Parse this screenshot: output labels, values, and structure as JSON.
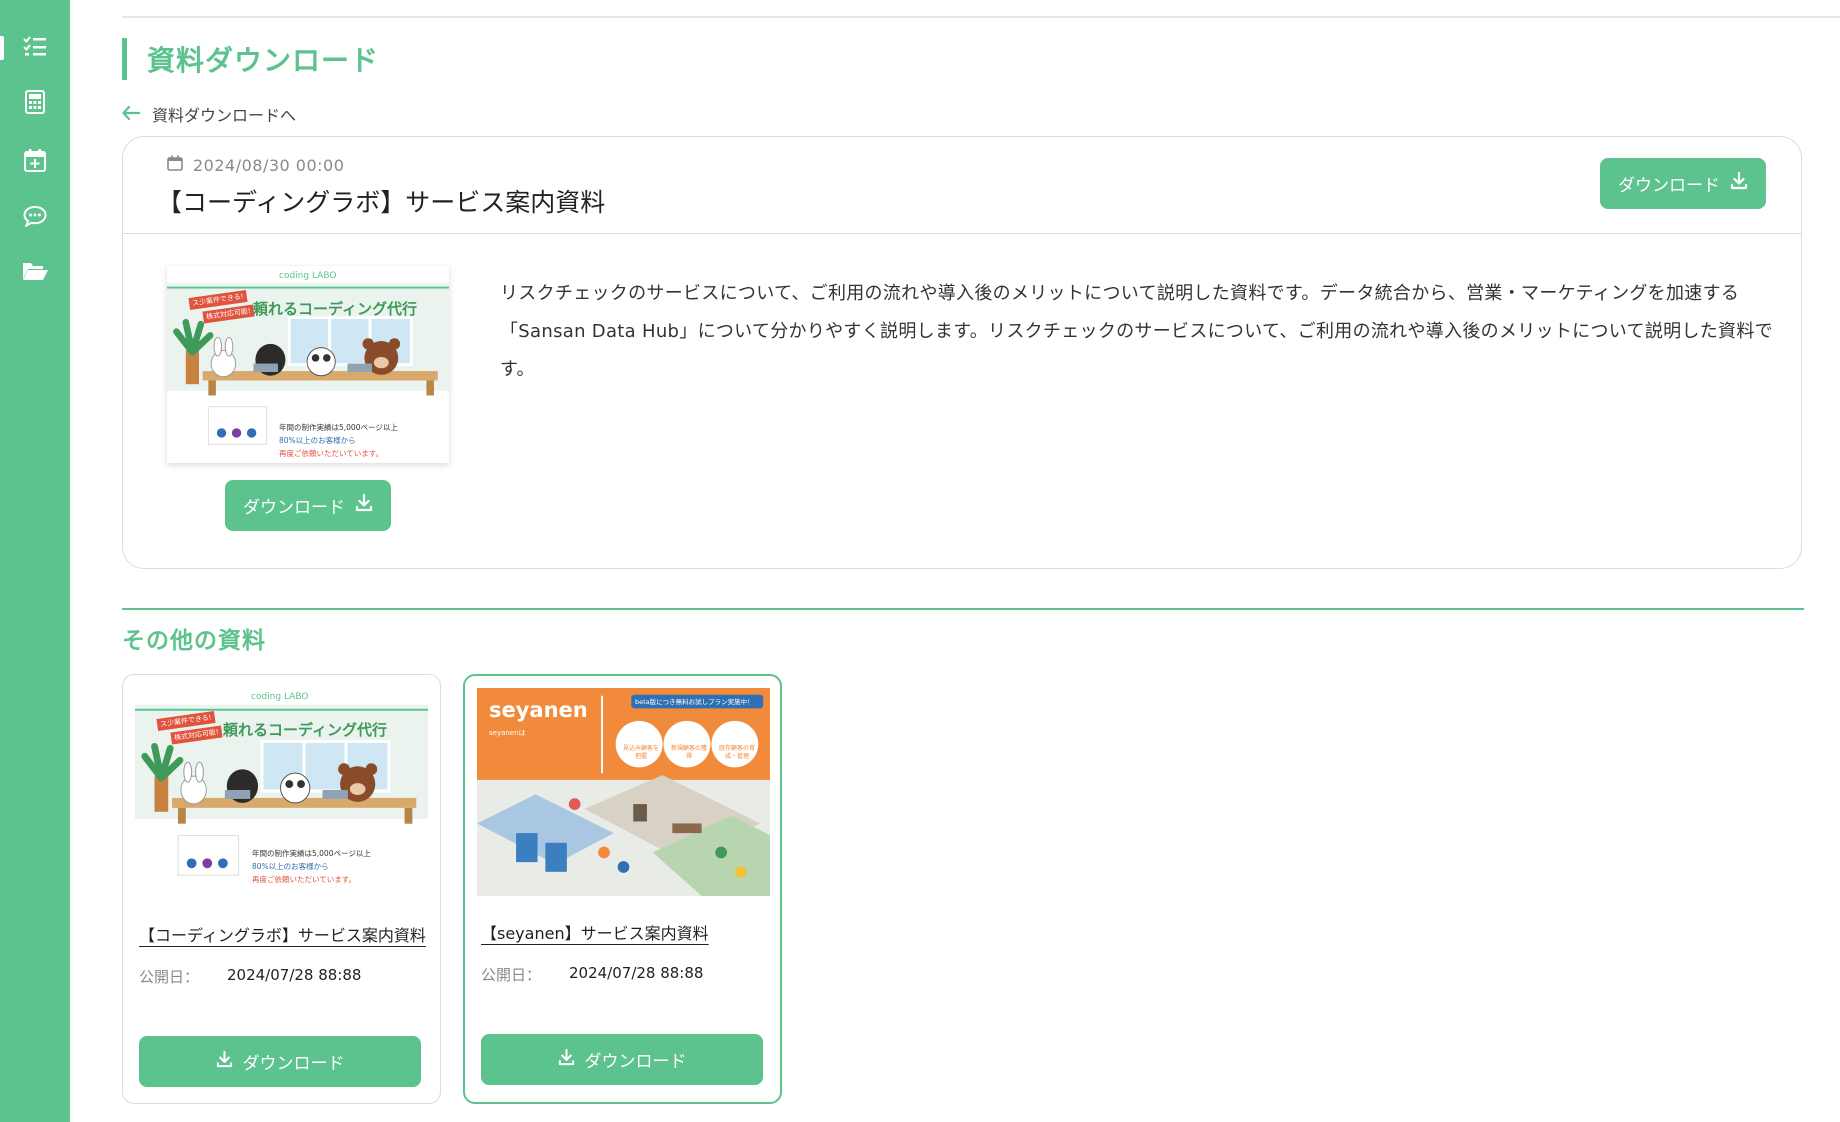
{
  "sidebar": {
    "accent_color": "#5cc28e",
    "items": [
      {
        "icon": "checklist-icon"
      },
      {
        "icon": "calculator-icon"
      },
      {
        "icon": "calendar-plus-icon"
      },
      {
        "icon": "chat-icon"
      },
      {
        "icon": "folder-open-icon"
      }
    ]
  },
  "page": {
    "title": "資料ダウンロード",
    "back_link": "資料ダウンロードへ"
  },
  "detail": {
    "date": "2024/08/30 00:00",
    "title": "【コーディングラボ】サービス案内資料",
    "download_label": "ダウンロード",
    "description": "リスクチェックのサービスについて、ご利用の流れや導入後のメリットについて説明した資料です。データ統合から、営業・マーケティングを加速する「Sansan Data Hub」について分かりやすく説明します。リスクチェックのサービスについて、ご利用の流れや導入後のメリットについて説明した資料です。",
    "thumbnail": {
      "logo": "coding LABO",
      "badge_1": "ス少案件できる!",
      "badge_2": "株式対応可能!",
      "headline": "頼れるコーディング代行",
      "stats_1": "年間の制作実績は5,000ページ以上",
      "stats_2": "80%以上のお客様から",
      "stats_3": "再度ご依頼いただいています。"
    }
  },
  "other": {
    "section_title": "その他の資料",
    "date_label": "公開日：",
    "cards": [
      {
        "title": "【コーディングラボ】サービス案内資料",
        "date": "2024/07/28 88:88",
        "download_label": "ダウンロード"
      },
      {
        "title": "【seyanen】サービス案内資料",
        "date": "2024/07/28 88:88",
        "download_label": "ダウンロード",
        "thumbnail": {
          "brand": "seyanen",
          "ribbon": "beta版につき無料お試しプラン実施中！",
          "sub_brand": "seyanenは",
          "circle_1": "見込み顧客を把握",
          "circle_2": "新規顧客の獲得",
          "circle_3": "既存顧客の育成・管理"
        }
      }
    ]
  }
}
